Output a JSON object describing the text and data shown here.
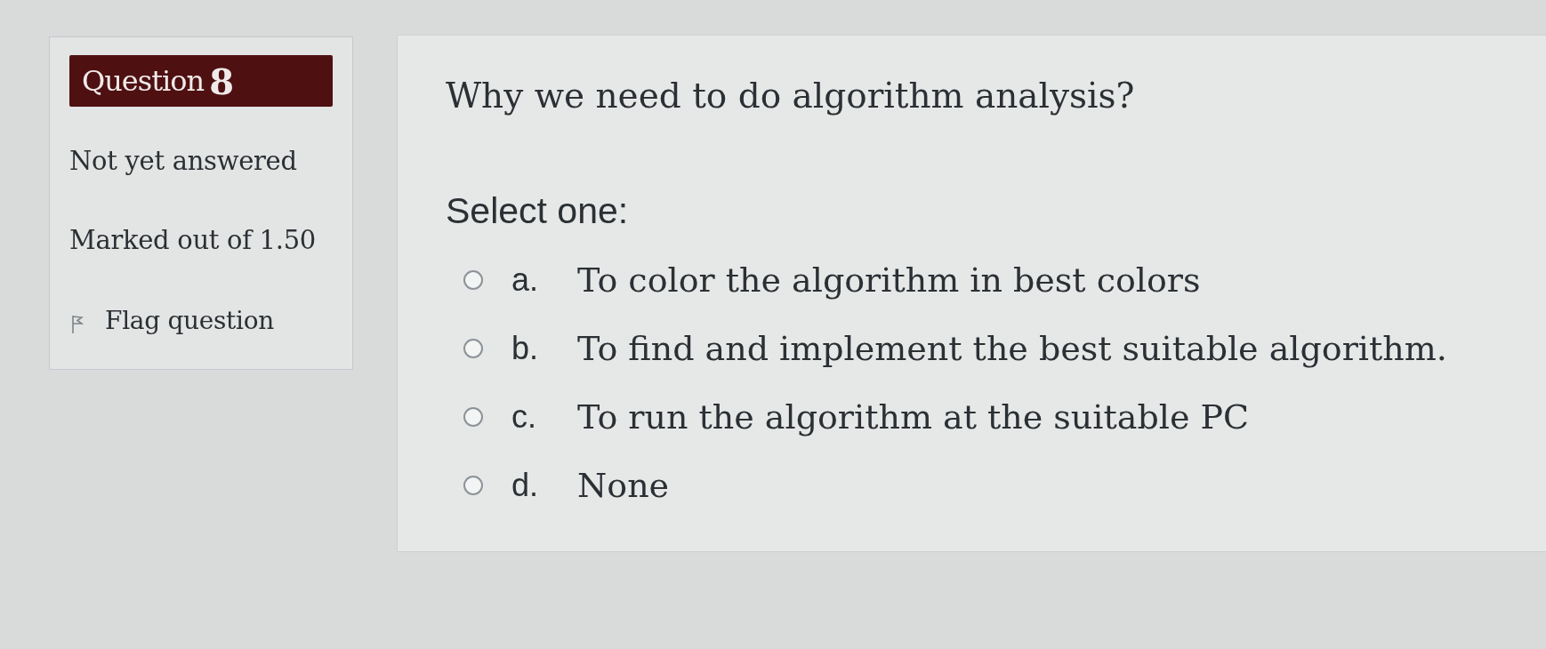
{
  "question_info": {
    "label": "Question",
    "number": "8",
    "state": "Not yet answered",
    "grade": "Marked out of 1.50",
    "flag_label": "Flag question"
  },
  "question": {
    "text": "Why we need to do algorithm analysis?",
    "prompt": "Select one:",
    "options": [
      {
        "letter": "a.",
        "text": "To color the algorithm in best colors",
        "selected": false
      },
      {
        "letter": "b.",
        "text": "To find and implement the best suitable algorithm.",
        "selected": false
      },
      {
        "letter": "c.",
        "text": "To run the algorithm at the suitable PC",
        "selected": false
      },
      {
        "letter": "d.",
        "text": "None",
        "selected": false
      }
    ]
  }
}
